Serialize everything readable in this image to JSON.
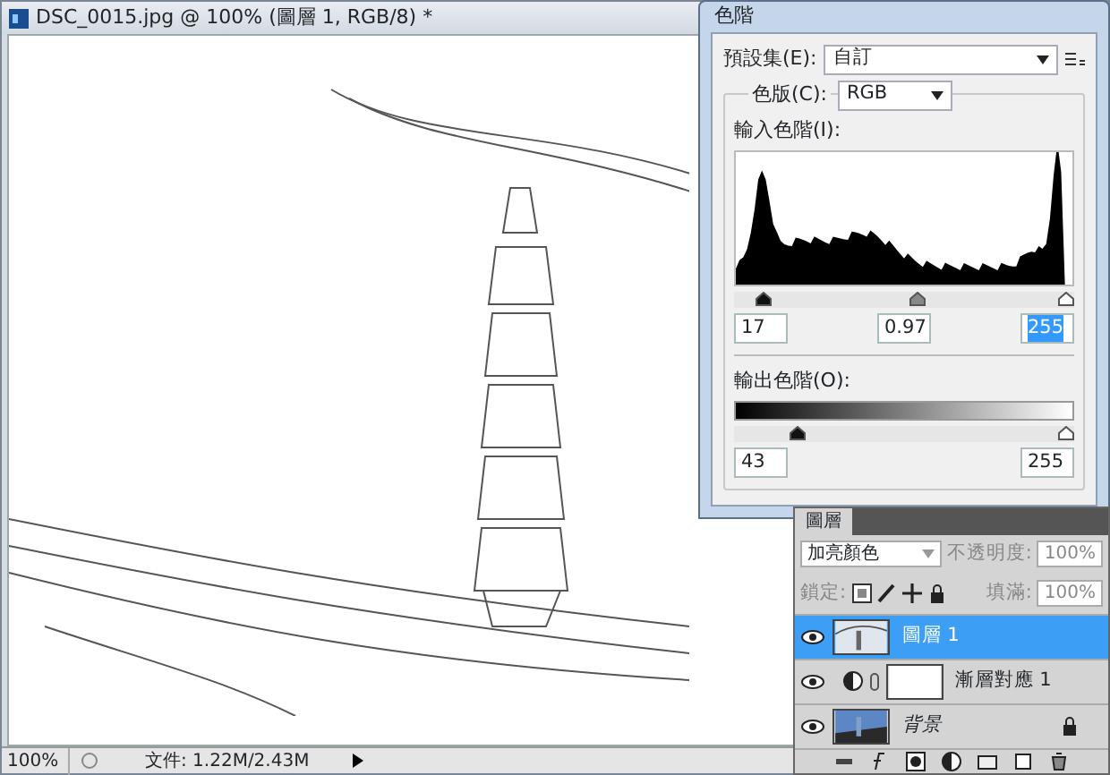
{
  "document": {
    "title": "DSC_0015.jpg @ 100% (圖層 1, RGB/8) *",
    "status_bar": {
      "zoom": "100%",
      "file_info": "文件: 1.22M/2.43M"
    }
  },
  "levels_dialog": {
    "title": "色階",
    "preset": {
      "label": "預設集(E):",
      "value": "自訂"
    },
    "channel": {
      "label": "色版(C):",
      "value": "RGB"
    },
    "input_levels": {
      "label": "輸入色階(I):",
      "thumbs": [
        {
          "kind": "black",
          "level": 0.067
        },
        {
          "kind": "gray",
          "level": 0.54
        },
        {
          "kind": "white",
          "level": 1
        }
      ],
      "fields": [
        {
          "value": "17",
          "selected": false
        },
        {
          "value": "0.97",
          "selected": false
        },
        {
          "value": "255",
          "selected": true
        }
      ]
    },
    "output_levels": {
      "label": "輸出色階(O):",
      "thumbs": [
        {
          "kind": "black",
          "level": 0.17
        },
        {
          "kind": "white",
          "level": 1
        }
      ],
      "fields": [
        {
          "value": "43",
          "selected": false
        },
        {
          "value": "255",
          "selected": false
        }
      ]
    }
  },
  "layers_panel": {
    "tab": "圖層",
    "blend_mode": "加亮顏色",
    "opacity_label": "不透明度:",
    "opacity": "100%",
    "lock_label": "鎖定:",
    "fill_label": "填滿:",
    "fill": "100%",
    "layers": [
      {
        "kind": "pixel",
        "name": "圖層 1",
        "selected": true,
        "visible": true
      },
      {
        "kind": "adjustment",
        "name": "漸層對應 1",
        "selected": false,
        "visible": true
      },
      {
        "kind": "background",
        "name": "背景",
        "selected": false,
        "visible": true
      }
    ]
  }
}
